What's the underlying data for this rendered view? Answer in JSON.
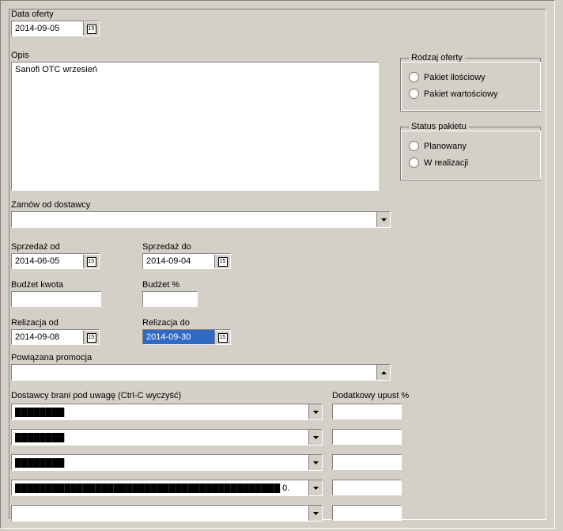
{
  "offerDate": {
    "label": "Data oferty",
    "value": "2014-09-05"
  },
  "description": {
    "label": "Opis",
    "value": "Sanofi OTC wrzesień"
  },
  "offerType": {
    "legend": "Rodzaj oferty",
    "options": [
      "Pakiet ilościowy",
      "Pakiet wartościowy"
    ],
    "selected": null
  },
  "packageStatus": {
    "legend": "Status pakietu",
    "options": [
      "Planowany",
      "W realizacji"
    ],
    "selected": null
  },
  "orderFromSupplier": {
    "label": "Zamów od dostawcy",
    "value": ""
  },
  "saleFrom": {
    "label": "Sprzedaż od",
    "value": "2014-06-05"
  },
  "saleTo": {
    "label": "Sprzedaż do",
    "value": "2014-09-04"
  },
  "budgetAmount": {
    "label": "Budżet kwota",
    "value": ""
  },
  "budgetPct": {
    "label": "Budżet %",
    "value": ""
  },
  "realFrom": {
    "label": "Relizacja od",
    "value": "2014-09-08"
  },
  "realTo": {
    "label": "Relizacja do",
    "value": "2014-09-30"
  },
  "relatedPromo": {
    "label": "Powiązana promocja",
    "value": ""
  },
  "suppliers": {
    "label": "Dostawcy brani pod uwagę (Ctrl-C wyczyść)",
    "discountLabel": "Dodatkowy upust %",
    "rows": [
      {
        "value": "████████",
        "discount": ""
      },
      {
        "value": "████████",
        "discount": ""
      },
      {
        "value": "████████",
        "discount": ""
      },
      {
        "value": "███████████████████████████████████████████ 0.",
        "discount": ""
      },
      {
        "value": "",
        "discount": ""
      }
    ]
  }
}
